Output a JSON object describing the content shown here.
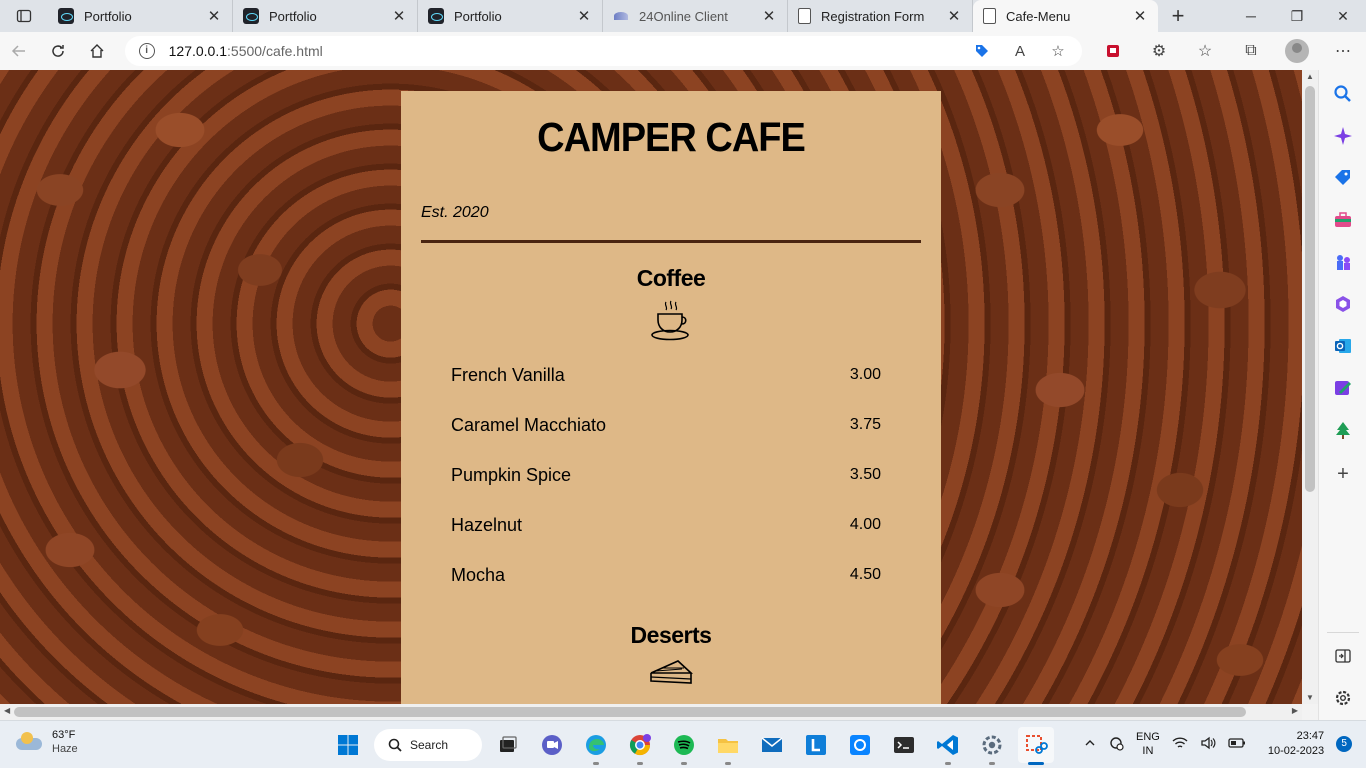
{
  "browser": {
    "tabs": [
      {
        "label": "Portfolio",
        "icon": "react-icon",
        "active": false
      },
      {
        "label": "Portfolio",
        "icon": "react-icon",
        "active": false
      },
      {
        "label": "Portfolio",
        "icon": "react-icon",
        "active": false
      },
      {
        "label": "24Online Client",
        "icon": "24online-icon",
        "active": false
      },
      {
        "label": "Registration Form",
        "icon": "page-icon",
        "active": false
      },
      {
        "label": "Cafe-Menu",
        "icon": "page-icon",
        "active": true
      }
    ],
    "url_host": "127.0.0.1",
    "url_path": ":5500/cafe.html"
  },
  "page": {
    "title": "CAMPER CAFE",
    "established": "Est. 2020",
    "sections": [
      {
        "title": "Coffee",
        "icon": "coffee-cup-icon",
        "items": [
          {
            "name": "French Vanilla",
            "price": "3.00"
          },
          {
            "name": "Caramel Macchiato",
            "price": "3.75"
          },
          {
            "name": "Pumpkin Spice",
            "price": "3.50"
          },
          {
            "name": "Hazelnut",
            "price": "4.00"
          },
          {
            "name": "Mocha",
            "price": "4.50"
          }
        ]
      },
      {
        "title": "Deserts",
        "icon": "pie-icon",
        "items": []
      }
    ],
    "menu_background": "#deb887"
  },
  "taskbar": {
    "weather_temp": "63°F",
    "weather_desc": "Haze",
    "search_label": "Search",
    "lang_top": "ENG",
    "lang_bottom": "IN",
    "time": "23:47",
    "date": "10-02-2023",
    "notification_count": "5"
  }
}
